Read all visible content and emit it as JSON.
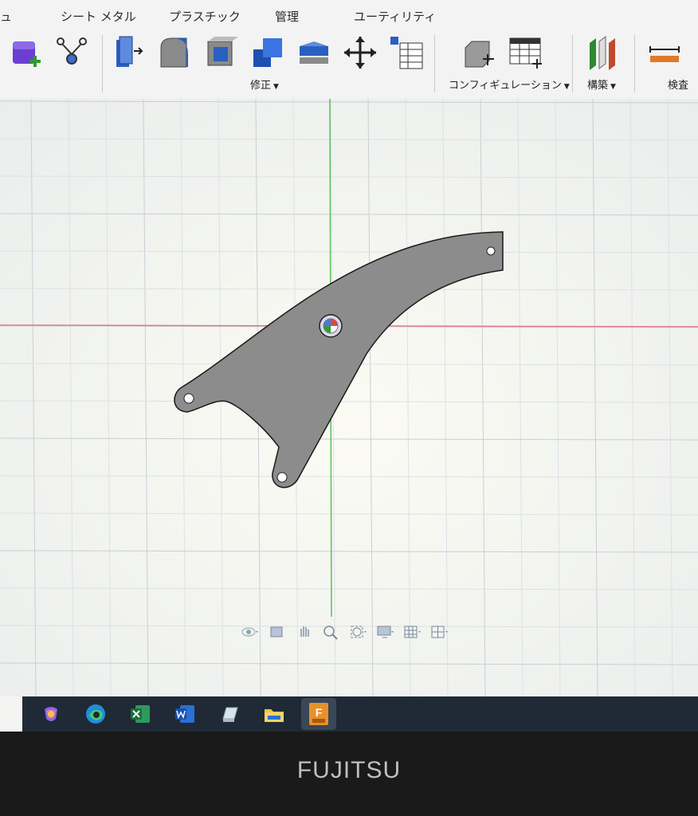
{
  "ribbon": {
    "tabs": [
      "ュ",
      "シート メタル",
      "プラスチック",
      "管理",
      "ユーティリティ"
    ],
    "groups": {
      "modify": "修正",
      "configuration": "コンフィギュレーション",
      "construct": "構築",
      "inspect": "検査"
    },
    "tools": [
      "new-component-icon",
      "joint-icon",
      "press-pull-icon",
      "fillet-icon",
      "shell-icon",
      "combine-icon",
      "offset-face-icon",
      "move-icon",
      "parameters-icon",
      "configure-icon",
      "configuration-table-icon",
      "midplane-icon",
      "measure-icon"
    ]
  },
  "viewport": {
    "grid": true,
    "x_axis_color": "#e07b8a",
    "y_axis_color": "#59c059",
    "part_fill": "#8c8c8c",
    "part_outline": "#1a1a1a"
  },
  "navbar": {
    "items": [
      "orbit-icon",
      "look-at-icon",
      "pan-icon",
      "zoom-icon",
      "fit-icon",
      "display-settings-icon",
      "grid-settings-icon",
      "viewports-icon"
    ]
  },
  "taskbar": {
    "apps": [
      "copilot-icon",
      "edge-icon",
      "excel-icon",
      "word-icon",
      "notes-icon",
      "file-explorer-icon",
      "fusion-icon"
    ],
    "active": "fusion-icon"
  },
  "bezel": {
    "brand": "FUJITSU"
  }
}
